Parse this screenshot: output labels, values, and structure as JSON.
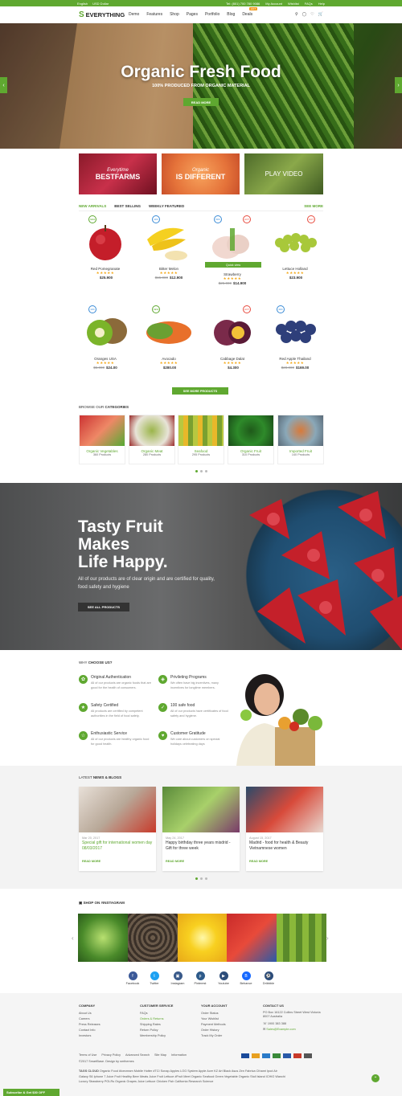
{
  "topbar": {
    "lang": "English",
    "currency": "USD Dollar",
    "tel": "Tel: (801) 700 780 9086",
    "account": "My Account",
    "wishlist": "Wishlist",
    "faqs": "FAQs",
    "help": "Help"
  },
  "header": {
    "logo": "EVERYTHING",
    "nav": [
      "Demo",
      "Features",
      "Shop",
      "Pages",
      "Portfolio",
      "Blog",
      "Deals"
    ],
    "deals_badge": "HOT"
  },
  "hero": {
    "title": "Organic Fresh Food",
    "subtitle": "100% PRODUCED FROM ORGANIC MATERIAL",
    "button": "READ MORE"
  },
  "banners": [
    {
      "small": "Everytime",
      "large": "BESTFARMS"
    },
    {
      "small": "Organic",
      "large": "IS DIFFERENT"
    },
    {
      "small": "",
      "large": "PLAY VIDEO"
    }
  ],
  "tabs": {
    "items": [
      "NEW ARRIVALS",
      "BEST SELLING",
      "WEEKLY FEATURED"
    ],
    "more": "SEE MORE"
  },
  "products": [
    {
      "badge": "NEW",
      "name": "Red Pomegranate",
      "old": "",
      "price": "$25.900"
    },
    {
      "badge": "10%",
      "name": "Bitter Melon",
      "old": "$15.000",
      "price": "$12.900"
    },
    {
      "badge": "50%",
      "name": "Strawberry",
      "old": "$25.000",
      "price": "$14.900"
    },
    {
      "badge": "HOT",
      "name": "Lettuce Holland",
      "old": "",
      "price": "$23.900"
    },
    {
      "badge": "10%",
      "name": "Oranges USA",
      "old": "$5.000",
      "price": "$24.00"
    },
    {
      "badge": "NEW",
      "name": "Avocado",
      "old": "",
      "price": "$280.00"
    },
    {
      "badge": "HOT",
      "name": "Cabbage Dalat",
      "old": "",
      "price": "$4.300"
    },
    {
      "badge": "40%",
      "name": "Red Apple Thailand",
      "old": "$28.000",
      "price": "$169.00"
    }
  ],
  "quick_view": "Quick view",
  "see_more_products": "SEE MORE PRODUCTS",
  "categories_title": {
    "pre": "BROWSE OUR",
    "bold": "CATEGORIES"
  },
  "categories": [
    {
      "name": "Organic Vegetables",
      "count": "360 Products"
    },
    {
      "name": "Organic Meat",
      "count": "280 Products"
    },
    {
      "name": "Seafood",
      "count": "295 Products"
    },
    {
      "name": "Organic Fruit",
      "count": "310 Products"
    },
    {
      "name": "Imported Fruit",
      "count": "140 Products"
    }
  ],
  "tasty": {
    "line1": "Tasty Fruit",
    "line2": "Makes",
    "line3": "Life Happy.",
    "text": "All of our products are of clear origin and are certified for quality, food safety and hygiene",
    "button": "SEE ALL PRODUCTS"
  },
  "why": {
    "pre": "WHY",
    "bold": "CHOOSE US?"
  },
  "features": [
    {
      "title": "Original Authentication",
      "desc": "All of our products are organic foods that are good for the health of consumers."
    },
    {
      "title": "Privileting Programs",
      "desc": "We often have big incentives, many incentives for longtime members."
    },
    {
      "title": "Safety Certified",
      "desc": "All products are certified by competent authorities in the field of food safety."
    },
    {
      "title": "100 safe food",
      "desc": "All of our products have certificates of food safety and hygiene."
    },
    {
      "title": "Enthusiastic Service",
      "desc": "All of our products are healthy organic food for good health."
    },
    {
      "title": "Customer Gratitude",
      "desc": "We care about customers on special holidays celebrating days"
    }
  ],
  "news_title": {
    "pre": "LATEST",
    "bold": "NEWS & BLOGS"
  },
  "news": [
    {
      "date": "Mar 20, 2017",
      "title": "Special gift for international women day 08/03/2017",
      "read": "READ MORE"
    },
    {
      "date": "May 24, 2017",
      "title": "Happy birthday three years misdrid - Gift for three week",
      "read": "READ MORE"
    },
    {
      "date": "August 15, 2017",
      "title": "Madrid - food for health & Beauty Vietnamnese women",
      "read": "READ MORE"
    }
  ],
  "insta_title": "SHOP ON #INSTAGRAM",
  "social": [
    "Facebook",
    "Twitter",
    "Instagram",
    "Pinterest",
    "Youtube",
    "Behance",
    "Dribbble"
  ],
  "footer": {
    "cols": [
      {
        "h": "COMPANY",
        "items": [
          "About Us",
          "Careers",
          "Press Releases",
          "Contact Info",
          "Investors"
        ]
      },
      {
        "h": "CUSTOMER SERVICE",
        "items": [
          "FAQs",
          "Orders & Returns",
          "Shipping Rates",
          "Return Policy",
          "Membership Policy"
        ]
      },
      {
        "h": "YOUR ACCOUNT",
        "items": [
          "Order Status",
          "Your Wishlist",
          "Payment Methods",
          "Order History",
          "Track My Order"
        ]
      },
      {
        "h": "CONTACT US",
        "items": [
          "PO Box 16122 Collins Street West Victoria 8007 Australia",
          "1900 383 388",
          "Sales@Example.com"
        ]
      }
    ],
    "links": [
      "Terms of Use",
      "Privacy Policy",
      "Advanced Search",
      "Site Map",
      "Information"
    ],
    "copyright": "©2017 SmartBase. Design by smthemes",
    "tags_label": "TAGS CLOUD",
    "tags1": "Organic Food  #Icecream  Mobile  Hotter  #TCI  Sonap  Apples  LOG  System  Apple  Acer  KZ  Art Black  Asus Zen  Fabrica  Cthanri  Ipod Air",
    "tags2": "Galaxy S6  Iphone 7  Juice Fruit  Healthy  Beer Meats  Juice Fruit  Lettuce  #Fruit  Meet Organic  Seafood  Green  Vegetable  Organic Stull Island  ICHIG  Wanchi",
    "tags3": "Luxury  Strawberry  POLRs  Organic Grapes  Juice  Lettuce  Chicken  Fish  California  Research  Science"
  },
  "subscribe": "Subscribe & Get $30 OFF"
}
